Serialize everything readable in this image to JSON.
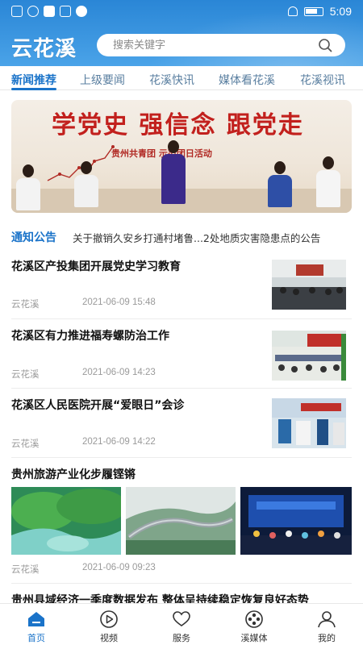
{
  "status_bar": {
    "time": "5:09"
  },
  "header": {
    "logo": "云花溪",
    "search_placeholder": "搜索关键字"
  },
  "tabs": [
    {
      "label": "新闻推荐",
      "active": true
    },
    {
      "label": "上级要闻",
      "active": false
    },
    {
      "label": "花溪快讯",
      "active": false
    },
    {
      "label": "媒体看花溪",
      "active": false
    },
    {
      "label": "花溪视讯",
      "active": false
    }
  ],
  "banner": {
    "title": "学党史 强信念 跟党走",
    "subtitle": "贵州共青团   示范团日活动"
  },
  "notice": {
    "label": "通知公告",
    "text": "关于撤销久安乡打通村堵鲁...2处地质灾害隐患点的公告"
  },
  "news": [
    {
      "title": "花溪区产投集团开展党史学习教育",
      "source": "云花溪",
      "date": "2021-06-09 15:48"
    },
    {
      "title": "花溪区有力推进福寿螺防治工作",
      "source": "云花溪",
      "date": "2021-06-09 14:23"
    },
    {
      "title": "花溪区人民医院开展“爱眼日”会诊",
      "source": "云花溪",
      "date": "2021-06-09 14:22"
    },
    {
      "title": "贵州旅游产业化步履铿锵",
      "source": "云花溪",
      "date": "2021-06-09 09:23"
    },
    {
      "title": "贵州县域经济一季度数据发布 整体呈持续稳定恢复良好态势"
    }
  ],
  "bottom_nav": [
    {
      "label": "首页",
      "icon": "home-icon",
      "active": true
    },
    {
      "label": "视频",
      "icon": "video-icon",
      "active": false
    },
    {
      "label": "服务",
      "icon": "heart-icon",
      "active": false
    },
    {
      "label": "溪媒体",
      "icon": "media-reel-icon",
      "active": false
    },
    {
      "label": "我的",
      "icon": "user-icon",
      "active": false
    }
  ],
  "colors": {
    "brand": "#1a73c9",
    "header_top": "#2a86d6",
    "banner_red": "#c2201d"
  }
}
